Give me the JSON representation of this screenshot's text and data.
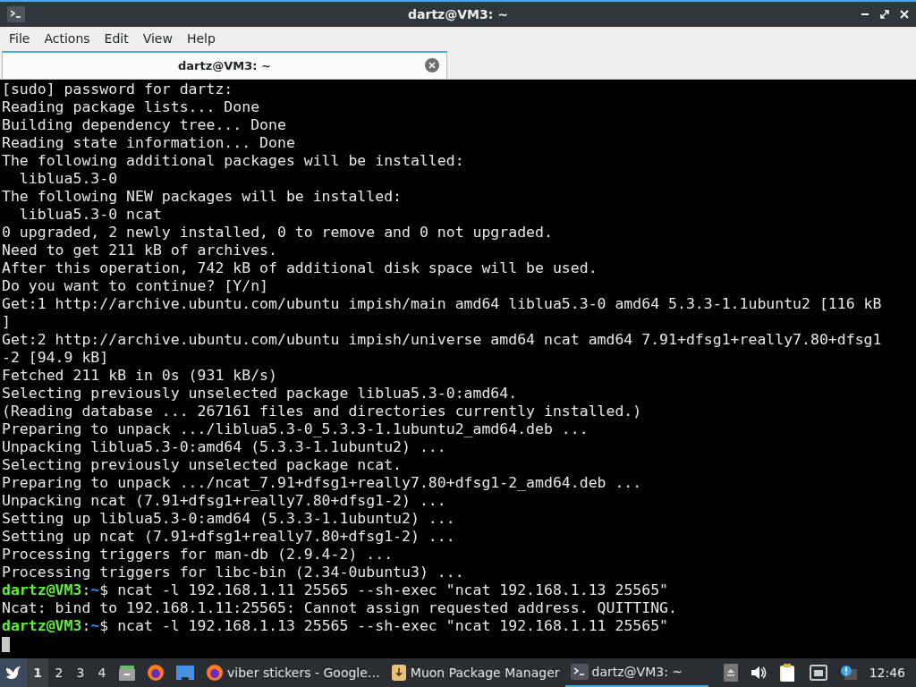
{
  "window": {
    "title": "dartz@VM3: ~"
  },
  "menu": [
    "File",
    "Actions",
    "Edit",
    "View",
    "Help"
  ],
  "tabs": [
    {
      "label": "dartz@VM3: ~",
      "selected": true
    }
  ],
  "terminal": {
    "lines": [
      {
        "kind": "output",
        "text": "[sudo] password for dartz:"
      },
      {
        "kind": "output",
        "text": "Reading package lists... Done"
      },
      {
        "kind": "output",
        "text": "Building dependency tree... Done"
      },
      {
        "kind": "output",
        "text": "Reading state information... Done"
      },
      {
        "kind": "output",
        "text": "The following additional packages will be installed:"
      },
      {
        "kind": "output",
        "text": "  liblua5.3-0"
      },
      {
        "kind": "output",
        "text": "The following NEW packages will be installed:"
      },
      {
        "kind": "output",
        "text": "  liblua5.3-0 ncat"
      },
      {
        "kind": "output",
        "text": "0 upgraded, 2 newly installed, 0 to remove and 0 not upgraded."
      },
      {
        "kind": "output",
        "text": "Need to get 211 kB of archives."
      },
      {
        "kind": "output",
        "text": "After this operation, 742 kB of additional disk space will be used."
      },
      {
        "kind": "output",
        "text": "Do you want to continue? [Y/n]"
      },
      {
        "kind": "output",
        "text": "Get:1 http://archive.ubuntu.com/ubuntu impish/main amd64 liblua5.3-0 amd64 5.3.3-1.1ubuntu2 [116 kB"
      },
      {
        "kind": "output",
        "text": "]"
      },
      {
        "kind": "output",
        "text": "Get:2 http://archive.ubuntu.com/ubuntu impish/universe amd64 ncat amd64 7.91+dfsg1+really7.80+dfsg1"
      },
      {
        "kind": "output",
        "text": "-2 [94.9 kB]"
      },
      {
        "kind": "output",
        "text": "Fetched 211 kB in 0s (931 kB/s)"
      },
      {
        "kind": "output",
        "text": "Selecting previously unselected package liblua5.3-0:amd64."
      },
      {
        "kind": "output",
        "text": "(Reading database ... 267161 files and directories currently installed.)"
      },
      {
        "kind": "output",
        "text": "Preparing to unpack .../liblua5.3-0_5.3.3-1.1ubuntu2_amd64.deb ..."
      },
      {
        "kind": "output",
        "text": "Unpacking liblua5.3-0:amd64 (5.3.3-1.1ubuntu2) ..."
      },
      {
        "kind": "output",
        "text": "Selecting previously unselected package ncat."
      },
      {
        "kind": "output",
        "text": "Preparing to unpack .../ncat_7.91+dfsg1+really7.80+dfsg1-2_amd64.deb ..."
      },
      {
        "kind": "output",
        "text": "Unpacking ncat (7.91+dfsg1+really7.80+dfsg1-2) ..."
      },
      {
        "kind": "output",
        "text": "Setting up liblua5.3-0:amd64 (5.3.3-1.1ubuntu2) ..."
      },
      {
        "kind": "output",
        "text": "Setting up ncat (7.91+dfsg1+really7.80+dfsg1-2) ..."
      },
      {
        "kind": "output",
        "text": "Processing triggers for man-db (2.9.4-2) ..."
      },
      {
        "kind": "output",
        "text": "Processing triggers for libc-bin (2.34-0ubuntu3) ..."
      },
      {
        "kind": "prompt",
        "user_host": "dartz@VM3",
        "separator": ":",
        "path": "~",
        "symbol": "$",
        "command": " ncat -l 192.168.1.11 25565 --sh-exec \"ncat 192.168.1.13 25565\""
      },
      {
        "kind": "output",
        "text": "Ncat: bind to 192.168.1.11:25565: Cannot assign requested address. QUITTING."
      },
      {
        "kind": "prompt",
        "user_host": "dartz@VM3",
        "separator": ":",
        "path": "~",
        "symbol": "$",
        "command": " ncat -l 192.168.1.13 25565 --sh-exec \"ncat 192.168.1.11 25565\""
      },
      {
        "kind": "cursor"
      }
    ]
  },
  "taskbar": {
    "workspaces": [
      {
        "label": "1",
        "selected": true
      },
      {
        "label": "2",
        "selected": false
      },
      {
        "label": "3",
        "selected": false
      },
      {
        "label": "4",
        "selected": false
      }
    ],
    "tasks": [
      {
        "kind": "browser",
        "label": "viber stickers - Google…",
        "selected": false
      },
      {
        "kind": "package",
        "label": "Muon Package Manager",
        "selected": false
      },
      {
        "kind": "terminal",
        "label": "dartz@VM3: ~",
        "selected": true
      }
    ],
    "clock": "12:46"
  }
}
